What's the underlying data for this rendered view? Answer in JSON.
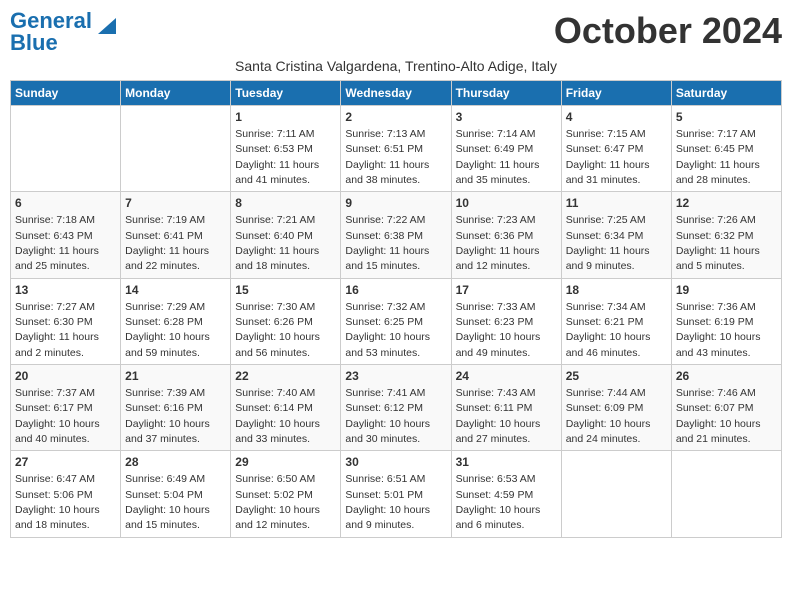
{
  "header": {
    "logo_general": "General",
    "logo_blue": "Blue",
    "month_title": "October 2024",
    "subtitle": "Santa Cristina Valgardena, Trentino-Alto Adige, Italy"
  },
  "days_of_week": [
    "Sunday",
    "Monday",
    "Tuesday",
    "Wednesday",
    "Thursday",
    "Friday",
    "Saturday"
  ],
  "weeks": [
    [
      {
        "day": "",
        "info": ""
      },
      {
        "day": "",
        "info": ""
      },
      {
        "day": "1",
        "info": "Sunrise: 7:11 AM\nSunset: 6:53 PM\nDaylight: 11 hours and 41 minutes."
      },
      {
        "day": "2",
        "info": "Sunrise: 7:13 AM\nSunset: 6:51 PM\nDaylight: 11 hours and 38 minutes."
      },
      {
        "day": "3",
        "info": "Sunrise: 7:14 AM\nSunset: 6:49 PM\nDaylight: 11 hours and 35 minutes."
      },
      {
        "day": "4",
        "info": "Sunrise: 7:15 AM\nSunset: 6:47 PM\nDaylight: 11 hours and 31 minutes."
      },
      {
        "day": "5",
        "info": "Sunrise: 7:17 AM\nSunset: 6:45 PM\nDaylight: 11 hours and 28 minutes."
      }
    ],
    [
      {
        "day": "6",
        "info": "Sunrise: 7:18 AM\nSunset: 6:43 PM\nDaylight: 11 hours and 25 minutes."
      },
      {
        "day": "7",
        "info": "Sunrise: 7:19 AM\nSunset: 6:41 PM\nDaylight: 11 hours and 22 minutes."
      },
      {
        "day": "8",
        "info": "Sunrise: 7:21 AM\nSunset: 6:40 PM\nDaylight: 11 hours and 18 minutes."
      },
      {
        "day": "9",
        "info": "Sunrise: 7:22 AM\nSunset: 6:38 PM\nDaylight: 11 hours and 15 minutes."
      },
      {
        "day": "10",
        "info": "Sunrise: 7:23 AM\nSunset: 6:36 PM\nDaylight: 11 hours and 12 minutes."
      },
      {
        "day": "11",
        "info": "Sunrise: 7:25 AM\nSunset: 6:34 PM\nDaylight: 11 hours and 9 minutes."
      },
      {
        "day": "12",
        "info": "Sunrise: 7:26 AM\nSunset: 6:32 PM\nDaylight: 11 hours and 5 minutes."
      }
    ],
    [
      {
        "day": "13",
        "info": "Sunrise: 7:27 AM\nSunset: 6:30 PM\nDaylight: 11 hours and 2 minutes."
      },
      {
        "day": "14",
        "info": "Sunrise: 7:29 AM\nSunset: 6:28 PM\nDaylight: 10 hours and 59 minutes."
      },
      {
        "day": "15",
        "info": "Sunrise: 7:30 AM\nSunset: 6:26 PM\nDaylight: 10 hours and 56 minutes."
      },
      {
        "day": "16",
        "info": "Sunrise: 7:32 AM\nSunset: 6:25 PM\nDaylight: 10 hours and 53 minutes."
      },
      {
        "day": "17",
        "info": "Sunrise: 7:33 AM\nSunset: 6:23 PM\nDaylight: 10 hours and 49 minutes."
      },
      {
        "day": "18",
        "info": "Sunrise: 7:34 AM\nSunset: 6:21 PM\nDaylight: 10 hours and 46 minutes."
      },
      {
        "day": "19",
        "info": "Sunrise: 7:36 AM\nSunset: 6:19 PM\nDaylight: 10 hours and 43 minutes."
      }
    ],
    [
      {
        "day": "20",
        "info": "Sunrise: 7:37 AM\nSunset: 6:17 PM\nDaylight: 10 hours and 40 minutes."
      },
      {
        "day": "21",
        "info": "Sunrise: 7:39 AM\nSunset: 6:16 PM\nDaylight: 10 hours and 37 minutes."
      },
      {
        "day": "22",
        "info": "Sunrise: 7:40 AM\nSunset: 6:14 PM\nDaylight: 10 hours and 33 minutes."
      },
      {
        "day": "23",
        "info": "Sunrise: 7:41 AM\nSunset: 6:12 PM\nDaylight: 10 hours and 30 minutes."
      },
      {
        "day": "24",
        "info": "Sunrise: 7:43 AM\nSunset: 6:11 PM\nDaylight: 10 hours and 27 minutes."
      },
      {
        "day": "25",
        "info": "Sunrise: 7:44 AM\nSunset: 6:09 PM\nDaylight: 10 hours and 24 minutes."
      },
      {
        "day": "26",
        "info": "Sunrise: 7:46 AM\nSunset: 6:07 PM\nDaylight: 10 hours and 21 minutes."
      }
    ],
    [
      {
        "day": "27",
        "info": "Sunrise: 6:47 AM\nSunset: 5:06 PM\nDaylight: 10 hours and 18 minutes."
      },
      {
        "day": "28",
        "info": "Sunrise: 6:49 AM\nSunset: 5:04 PM\nDaylight: 10 hours and 15 minutes."
      },
      {
        "day": "29",
        "info": "Sunrise: 6:50 AM\nSunset: 5:02 PM\nDaylight: 10 hours and 12 minutes."
      },
      {
        "day": "30",
        "info": "Sunrise: 6:51 AM\nSunset: 5:01 PM\nDaylight: 10 hours and 9 minutes."
      },
      {
        "day": "31",
        "info": "Sunrise: 6:53 AM\nSunset: 4:59 PM\nDaylight: 10 hours and 6 minutes."
      },
      {
        "day": "",
        "info": ""
      },
      {
        "day": "",
        "info": ""
      }
    ]
  ]
}
